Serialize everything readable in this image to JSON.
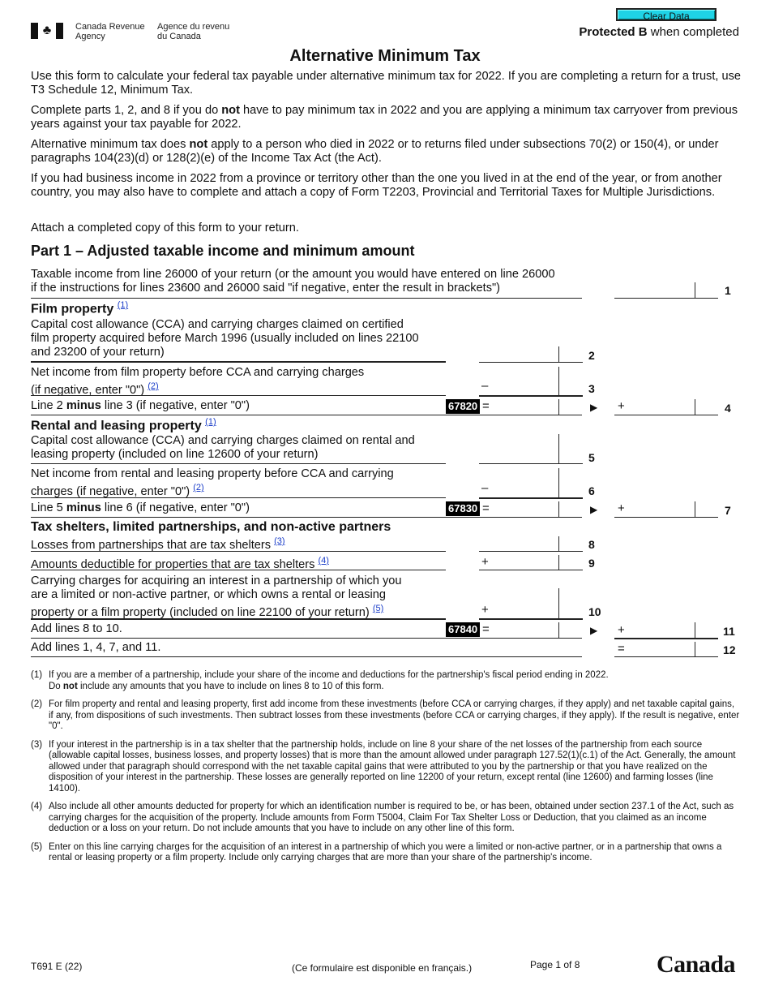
{
  "header": {
    "agency_en_line1": "Canada Revenue",
    "agency_en_line2": "Agency",
    "agency_fr_line1": "Agence du revenu",
    "agency_fr_line2": "du Canada",
    "clear_button": "Clear Data",
    "protected_bold": "Protected B",
    "protected_rest": " when completed",
    "logo_icon": "canada-flag-icon"
  },
  "title": "Alternative Minimum Tax",
  "intro": {
    "p1": "Use this form to calculate your federal tax payable under alternative minimum tax for 2022. If you are completing a return for a trust, use T3 Schedule 12, Minimum Tax.",
    "p2_a": "Complete parts 1, 2, and 8 if you do ",
    "p2_b": "not",
    "p2_c": " have to pay minimum tax in 2022 and you are applying a minimum tax carryover from previous years against your tax payable for 2022.",
    "p3_a": "Alternative minimum tax does ",
    "p3_b": "not",
    "p3_c": " apply to a person who died in 2022 or to returns filed under subsections 70(2) or 150(4), or under paragraphs 104(23)(d) or 128(2)(e) of the Income Tax Act (the Act).",
    "p4": "If you had business income in 2022 from a province or territory other than the one you lived in at the end of the year, or from another country, you may also have to complete and attach a copy of Form T2203, Provincial and Territorial Taxes for Multiple Jurisdictions.",
    "p5": "Attach a completed copy of this form to your return."
  },
  "part1": {
    "title": "Part 1 – Adjusted taxable income and minimum amount",
    "line1_text_1": "Taxable income from line 26000 of your return (or the amount you would have entered on line 26000",
    "line1_text_2": "if the instructions for lines 23600 and 26000 said \"if negative, enter the result in brackets\")",
    "film_heading": "Film property",
    "film_fn": "(1)",
    "line2_text_1": "Capital cost allowance (CCA) and carrying charges claimed on certified",
    "line2_text_2": "film property acquired before March 1996 (usually included on lines 22100",
    "line2_text_3": "and 23200 of your return)",
    "line3_text_1": "Net income from film property before CCA and carrying charges",
    "line3_text_2": "(if negative, enter \"0\") ",
    "line3_fn": "(2)",
    "line4_a": "Line 2 ",
    "line4_b": "minus",
    "line4_c": " line 3 (if negative, enter \"0\")",
    "line4_code": "67820",
    "rental_heading": "Rental and leasing property",
    "rental_fn": "(1)",
    "line5_text_1": "Capital cost allowance (CCA) and carrying charges claimed on rental and",
    "line5_text_2": "leasing property (included on line 12600 of your return)",
    "line6_text_1": "Net income from rental and leasing property before CCA and carrying",
    "line6_text_2": "charges (if negative, enter \"0\") ",
    "line6_fn": "(2)",
    "line7_a": "Line 5 ",
    "line7_b": "minus",
    "line7_c": " line 6 (if negative, enter \"0\")",
    "line7_code": "67830",
    "shelter_heading": "Tax shelters, limited partnerships, and non-active partners",
    "line8_text": "Losses from partnerships that are tax shelters ",
    "line8_fn": "(3)",
    "line9_text": "Amounts deductible for properties that are tax shelters ",
    "line9_fn": "(4)",
    "line10_text_1": "Carrying charges for acquiring an interest in a partnership of which you",
    "line10_text_2": "are a limited or non-active partner, or which owns a rental or leasing",
    "line10_text_3": "property or a film property (included on line 22100 of your return) ",
    "line10_fn": "(5)",
    "line11_text": "Add lines 8 to 10.",
    "line11_code": "67840",
    "line12_text": "Add lines 1, 4, 7, and 11.",
    "ops": {
      "minus": "–",
      "plus": "+",
      "equals": "=",
      "arrow": "▶"
    },
    "line_numbers": [
      "1",
      "2",
      "3",
      "4",
      "5",
      "6",
      "7",
      "8",
      "9",
      "10",
      "11",
      "12"
    ],
    "fields": {
      "line1": "",
      "line2": "",
      "line3": "",
      "line4_left": "",
      "line4": "",
      "line5": "",
      "line6": "",
      "line7_left": "",
      "line7": "",
      "line8": "",
      "line9": "",
      "line10": "",
      "line11_left": "",
      "line11": "",
      "line12": ""
    }
  },
  "notes": [
    {
      "n": "(1)",
      "a": "If you are a member of a partnership, include your share of the income and deductions for the partnership's fiscal period ending in 2022.",
      "b1": "Do ",
      "bold": "not",
      "b2": " include any amounts that you have to include on lines 8 to 10 of this form."
    },
    {
      "n": "(2)",
      "text": "For film property and rental and leasing property, first add income from these investments (before CCA or carrying charges, if they apply) and net taxable capital gains, if any, from dispositions of such investments. Then subtract losses from these investments (before CCA or carrying charges, if they apply). If the result is negative, enter \"0\"."
    },
    {
      "n": "(3)",
      "text": "If your interest in the partnership is in a tax shelter that the partnership holds, include on line 8 your share of the net losses of the partnership from each source (allowable capital losses, business losses, and property losses) that is more than the amount allowed under paragraph 127.52(1)(c.1) of the Act. Generally, the amount allowed under that paragraph should correspond with the net taxable capital gains that were attributed to you by the partnership or that you have realized on the disposition of your interest in the partnership. These losses are generally reported on line 12200 of your return, except rental (line 12600) and farming losses (line 14100)."
    },
    {
      "n": "(4)",
      "text": "Also include all other amounts deducted for property for which an identification number is required to be, or has been, obtained under section 237.1 of the Act, such as carrying charges for the acquisition of the property. Include amounts from Form T5004, Claim For Tax Shelter Loss or Deduction, that you claimed as an income deduction or a loss on your return. Do not include amounts that you have to include on any other line of this form."
    },
    {
      "n": "(5)",
      "text": "Enter on this line carrying charges for the acquisition of an interest in a partnership of which you were a limited or non-active partner, or in a partnership that owns a rental or leasing property or a film property. Include only carrying charges that are more than your share of the partnership's income."
    }
  ],
  "footer": {
    "form_id": "T691 E (22)",
    "french_note": "(Ce formulaire est disponible en français.)",
    "page": "Page 1 of 8",
    "wordmark": "Canada"
  }
}
